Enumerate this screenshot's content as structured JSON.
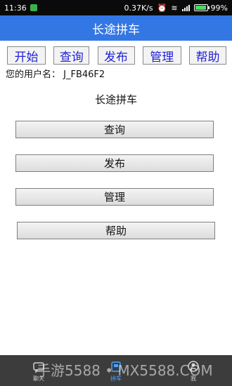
{
  "status_bar": {
    "time": "11:36",
    "network_speed": "0.37K/s",
    "battery_percent": "99%",
    "battery_level": 0.99,
    "signal_label": "4G"
  },
  "title_bar": {
    "title": "长途拼车"
  },
  "toolbar": {
    "buttons": [
      {
        "label": "开始"
      },
      {
        "label": "查询"
      },
      {
        "label": "发布"
      },
      {
        "label": "管理"
      },
      {
        "label": "帮助"
      }
    ]
  },
  "user": {
    "label": "您的用户名：",
    "username": "J_FB46F2"
  },
  "main": {
    "heading": "长途拼车",
    "buttons": [
      {
        "label": "查询"
      },
      {
        "label": "发布"
      },
      {
        "label": "管理"
      },
      {
        "label": "帮助"
      }
    ]
  },
  "bottom_nav": {
    "tabs": [
      {
        "label": "聊天",
        "icon": "chat-icon",
        "active": false
      },
      {
        "label": "拼车",
        "icon": "car-icon",
        "active": true
      },
      {
        "label": "我",
        "icon": "profile-icon",
        "active": false
      }
    ]
  },
  "watermark": {
    "text": "手游5588 • MX5588.COM"
  },
  "colors": {
    "title_bar": "#3377e4",
    "toolbar_text": "#2222d6",
    "nav_active": "#4aa3ff",
    "nav_bg": "#3c3c3c"
  }
}
